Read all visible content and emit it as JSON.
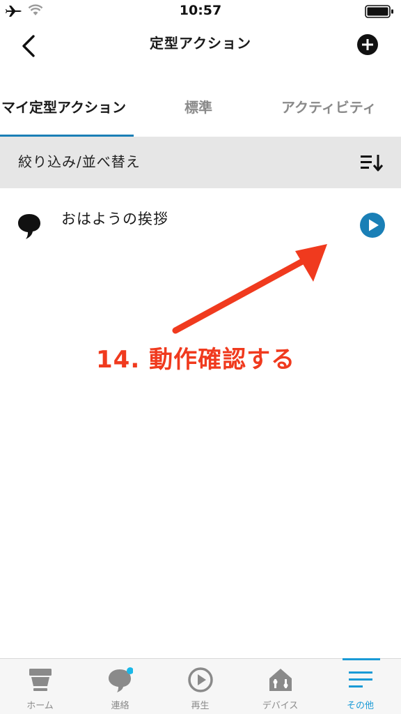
{
  "status_bar": {
    "time": "10:57",
    "icons": [
      "airplane-icon",
      "wifi-icon",
      "battery-icon"
    ]
  },
  "header": {
    "title": "定型アクション",
    "back_icon": "chevron-left-icon",
    "add_icon": "plus-circle-icon"
  },
  "tabs": [
    {
      "label": "マイ定型アクション",
      "active": true
    },
    {
      "label": "標準",
      "active": false
    },
    {
      "label": "アクティビティ",
      "active": false
    }
  ],
  "filter": {
    "label": "絞り込み/並べ替え",
    "icon": "sort-icon"
  },
  "routines": [
    {
      "name": "おはようの挨拶",
      "icon": "speech-bubble-icon",
      "action_icon": "play-icon"
    }
  ],
  "annotation": {
    "text": "14. 動作確認する",
    "color": "#f03a1e"
  },
  "bottom_nav": [
    {
      "label": "ホーム",
      "icon": "home-icon",
      "active": false
    },
    {
      "label": "連絡",
      "icon": "chat-icon",
      "active": false,
      "badge": true
    },
    {
      "label": "再生",
      "icon": "play-icon",
      "active": false
    },
    {
      "label": "デバイス",
      "icon": "device-icon",
      "active": false
    },
    {
      "label": "その他",
      "icon": "menu-icon",
      "active": true
    }
  ],
  "colors": {
    "accent": "#1a7fb6",
    "nav_active": "#1a9ad6",
    "filter_bg": "#e6e6e6"
  }
}
